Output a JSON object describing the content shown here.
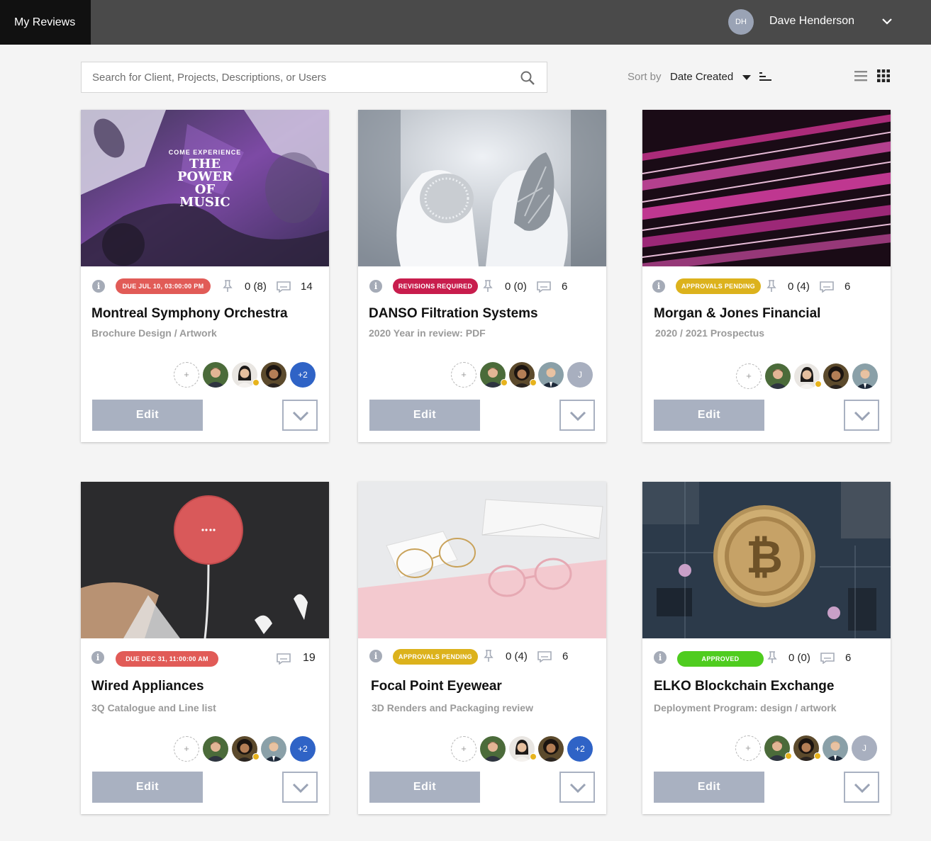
{
  "header": {
    "app_title": "My Reviews",
    "user_initials": "DH",
    "user_name": "Dave Henderson"
  },
  "toolbar": {
    "search_placeholder": "Search for Client, Projects, Descriptions, or Users",
    "sort_label": "Sort by",
    "sort_value": "Date Created"
  },
  "cards": [
    {
      "badge": "DUE JUL 10, 03:00:00 PM",
      "badge_color": "#e15b57",
      "pins": "0 (8)",
      "comments": "14",
      "title": "Montreal Symphony Orchestra",
      "subtitle": "Brochure Design / Artwork",
      "extra_reviewers": "+2",
      "edit_label": "Edit",
      "thumb": {
        "line1": "COME EXPERIENCE",
        "line2": "THE",
        "line3": "POWER",
        "line4": "OF",
        "line5": "MUSIC"
      }
    },
    {
      "badge": "REVISIONS REQUIRED",
      "badge_color": "#c81d4d",
      "pins": "0 (0)",
      "comments": "6",
      "title": "DANSO Filtration Systems",
      "subtitle": "2020 Year in review: PDF",
      "extra_reviewers": "J",
      "edit_label": "Edit"
    },
    {
      "badge": "APPROVALS PENDING",
      "badge_color": "#dcb21c",
      "pins": "0 (4)",
      "comments": "6",
      "title": "Morgan & Jones Financial",
      "subtitle": "2020 / 2021 Prospectus",
      "edit_label": "Edit"
    },
    {
      "badge": "DUE DEC 31, 11:00:00 AM",
      "badge_color": "#e15b57",
      "comments": "19",
      "title": "Wired Appliances",
      "subtitle": "3Q Catalogue and Line list",
      "extra_reviewers": "+2",
      "edit_label": "Edit"
    },
    {
      "badge": "APPROVALS PENDING",
      "badge_color": "#dcb21c",
      "pins": "0 (4)",
      "comments": "6",
      "title": "Focal Point Eyewear",
      "subtitle": "3D Renders and Packaging review",
      "extra_reviewers": "+2",
      "edit_label": "Edit"
    },
    {
      "badge": "APPROVED",
      "badge_color": "#4fcc1f",
      "pins": "0 (0)",
      "comments": "6",
      "title": "ELKO Blockchain Exchange",
      "subtitle": "Deployment Program: design / artwork",
      "extra_reviewers": "J",
      "edit_label": "Edit"
    }
  ],
  "icons": {
    "search": "search-icon",
    "chevron": "chevron-down-icon",
    "pin": "pin-icon",
    "comment": "comment-icon",
    "info": "info-icon",
    "list_view": "list-view-icon",
    "grid_view": "grid-view-icon",
    "sort_direction": "sort-direction-icon"
  },
  "colors": {
    "topbar": "#4a4a4a",
    "brand_tab": "#111111",
    "button": "#a9b1c1",
    "overflow_blue": "#2f63c6",
    "overflow_grey": "#a8afbf",
    "online_dot": "#e7b31d"
  }
}
